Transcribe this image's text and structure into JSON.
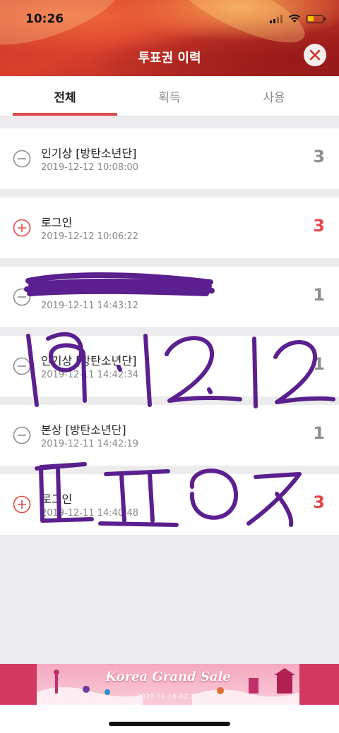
{
  "status_bar": {
    "time": "10:26"
  },
  "header": {
    "title": "투표권 이력",
    "close_icon": "close-icon"
  },
  "tabs": [
    {
      "label": "전체",
      "active": true
    },
    {
      "label": "획득",
      "active": false
    },
    {
      "label": "사용",
      "active": false
    }
  ],
  "history": [
    {
      "type": "minus",
      "name": "인기상 [방탄소년단]",
      "date": "2019-12-12 10:08:00",
      "count": "3"
    },
    {
      "type": "plus",
      "name": "로그인",
      "date": "2019-12-12 10:06:22",
      "count": "3"
    },
    {
      "type": "minus",
      "name": "",
      "date": "2019-12-11 14:43:12",
      "count": "1"
    },
    {
      "type": "minus",
      "name": "인기상 [방탄소년단]",
      "date": "2019-12-11 14:42:34",
      "count": "1"
    },
    {
      "type": "minus",
      "name": "본상 [방탄소년단]",
      "date": "2019-12-11 14:42:19",
      "count": "1"
    },
    {
      "type": "plus",
      "name": "로그인",
      "date": "2019-12-11 14:40:48",
      "count": "3"
    }
  ],
  "handwriting": {
    "line1": "19.12.12",
    "line2": "ㄸㅍㅇㅈ"
  },
  "ad": {
    "title": "Korea Grand Sale",
    "date": "2020.01.16-02.29"
  },
  "colors": {
    "accent": "#e34848",
    "minus": "#8e8e93",
    "marker": "#5b1f8f",
    "ad": "#d33863"
  }
}
